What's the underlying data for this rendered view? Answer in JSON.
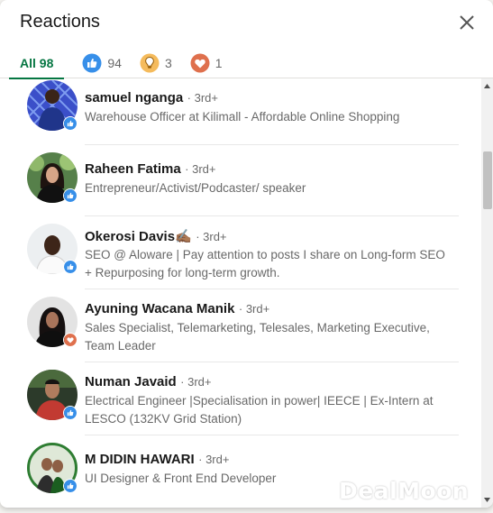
{
  "modal": {
    "title": "Reactions",
    "tabs": [
      {
        "label": "All 98"
      },
      {
        "count": "94",
        "icon": "like-icon"
      },
      {
        "count": "3",
        "icon": "insightful-icon"
      },
      {
        "count": "1",
        "icon": "love-icon"
      }
    ]
  },
  "people": [
    {
      "name": "samuel nganga",
      "degree": "· 3rd+",
      "headline": "Warehouse Officer at Kilimall - Affordable Online Shopping",
      "reaction": "like-icon"
    },
    {
      "name": "Raheen Fatima",
      "degree": "· 3rd+",
      "headline": "Entrepreneur/Activist/Podcaster/ speaker",
      "reaction": "like-icon"
    },
    {
      "name": "Okerosi Davis",
      "emoji": "✍🏾",
      "degree": "· 3rd+",
      "headline": "SEO @ Aloware | Pay attention to posts I share on Long-form SEO + Repurposing for long-term growth.",
      "reaction": "like-icon"
    },
    {
      "name": "Ayuning Wacana Manik",
      "degree": "· 3rd+",
      "headline": "Sales Specialist, Telemarketing, Telesales, Marketing Executive, Team Leader",
      "reaction": "love-icon"
    },
    {
      "name": "Numan Javaid",
      "degree": "· 3rd+",
      "headline": "Electrical Engineer |Specialisation in power| IEECE | Ex-Intern at LESCO (132KV Grid Station)",
      "reaction": "like-icon"
    },
    {
      "name": "M DIDIN HAWARI",
      "degree": "· 3rd+",
      "headline": "UI Designer & Front End Developer",
      "reaction": "like-icon"
    }
  ],
  "watermark": "DealMoon",
  "colors": {
    "accent": "#057642",
    "like": "#378fe9",
    "insightful": "#f5bb5c",
    "love": "#df704d"
  }
}
